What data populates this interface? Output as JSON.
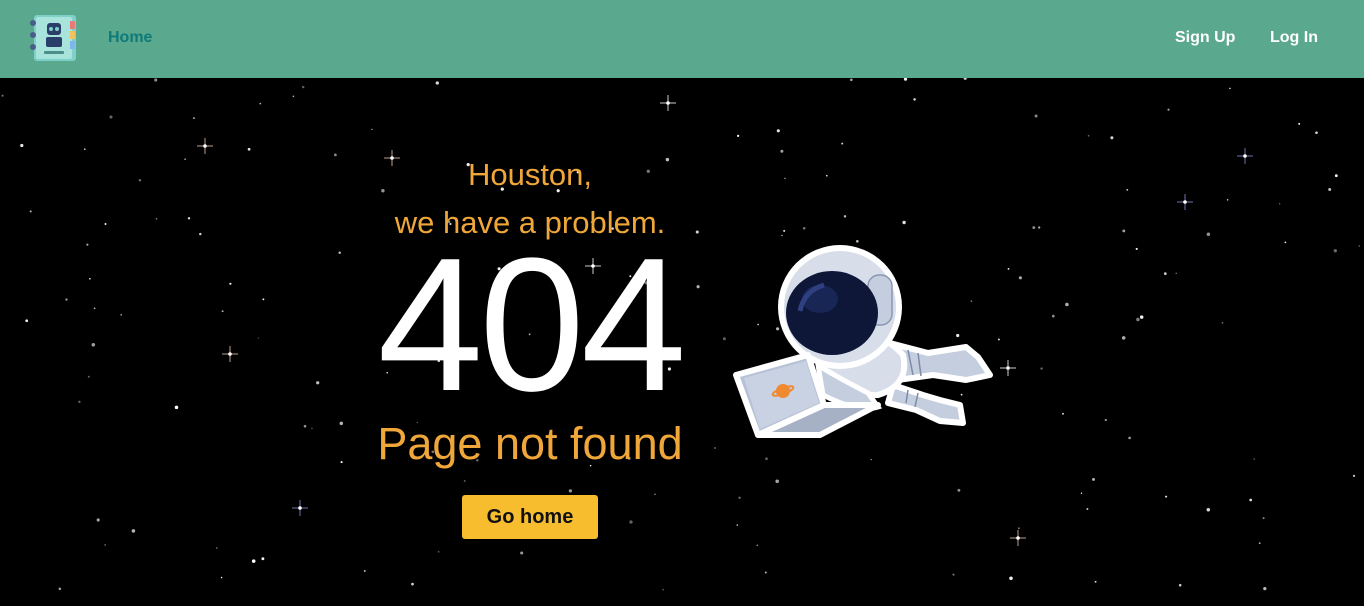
{
  "navbar": {
    "logo_icon": "address-book-robot-logo",
    "home_label": "Home",
    "signup_label": "Sign Up",
    "login_label": "Log In"
  },
  "hero": {
    "line1": "Houston,",
    "line2": "we have a problem.",
    "code": "404",
    "message": "Page not found",
    "button_label": "Go home",
    "illustration_icon": "astronaut-with-laptop-illustration"
  },
  "colors": {
    "navbar_bg": "#5aa98e",
    "home_link": "#0f7a78",
    "accent_text": "#f0a73a",
    "button_bg": "#f7bd2f",
    "page_bg": "#000000"
  }
}
